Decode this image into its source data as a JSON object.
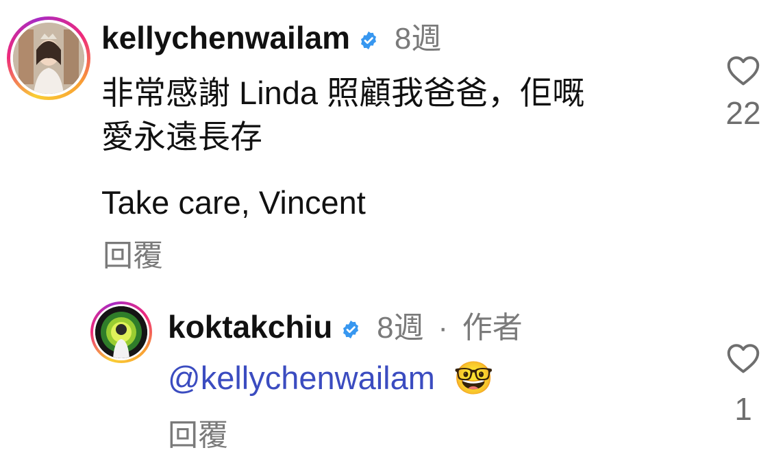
{
  "comments": [
    {
      "username": "kellychenwailam",
      "verified": true,
      "time": "8週",
      "lines": [
        "非常感謝 Linda 照顧我爸爸，佢嘅",
        "愛永遠長存"
      ],
      "extra_line": "Take care, Vincent",
      "reply_label": "回覆",
      "like_count": "22"
    },
    {
      "username": "koktakchiu",
      "verified": true,
      "time": "8週",
      "separator": "·",
      "author_label": "作者",
      "mention": "@kellychenwailam",
      "emoji": "🤓",
      "reply_label": "回覆",
      "like_count": "1"
    }
  ],
  "icons": {
    "verified": "verified-badge-icon",
    "like": "heart-outline-icon"
  },
  "colors": {
    "verified_blue": "#3797f0",
    "mention_blue": "#3b4cc0",
    "meta_gray": "#7a7a7a"
  }
}
